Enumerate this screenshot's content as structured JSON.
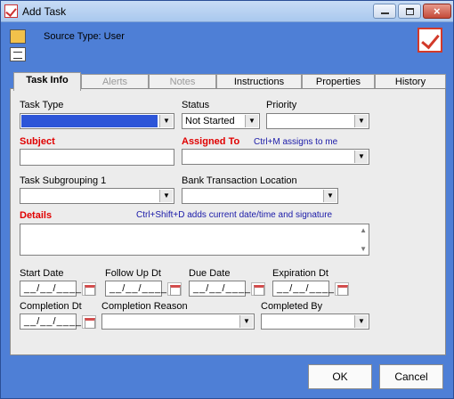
{
  "window": {
    "title": "Add Task",
    "source_type": "Source Type: User",
    "title_icon": "task-check-icon",
    "minimize": "minimize",
    "maximize": "maximize",
    "close": "close"
  },
  "tabs": [
    "Task Info",
    "Alerts",
    "Notes",
    "Instructions",
    "Properties",
    "History"
  ],
  "fields": {
    "task_type": {
      "label": "Task Type",
      "value": ""
    },
    "status": {
      "label": "Status",
      "value": "Not Started"
    },
    "priority": {
      "label": "Priority",
      "value": ""
    },
    "subject": {
      "label": "Subject",
      "value": ""
    },
    "assigned_to": {
      "label": "Assigned To",
      "hint": "Ctrl+M assigns to me",
      "value": ""
    },
    "task_subgrouping": {
      "label": "Task Subgrouping 1",
      "value": ""
    },
    "bank_transaction_location": {
      "label": "Bank Transaction Location",
      "value": ""
    },
    "details": {
      "label": "Details",
      "hint": "Ctrl+Shift+D adds current date/time and signature",
      "value": ""
    },
    "start_date": {
      "label": "Start Date",
      "value": "__/__/____"
    },
    "follow_up_dt": {
      "label": "Follow Up Dt",
      "value": "__/__/____"
    },
    "due_date": {
      "label": "Due Date",
      "value": "__/__/____"
    },
    "expiration_dt": {
      "label": "Expiration Dt",
      "value": "__/__/____"
    },
    "completion_dt": {
      "label": "Completion Dt",
      "value": "__/__/____"
    },
    "completion_reason": {
      "label": "Completion Reason",
      "value": ""
    },
    "completed_by": {
      "label": "Completed By",
      "value": ""
    }
  },
  "buttons": {
    "ok": "OK",
    "cancel": "Cancel"
  }
}
